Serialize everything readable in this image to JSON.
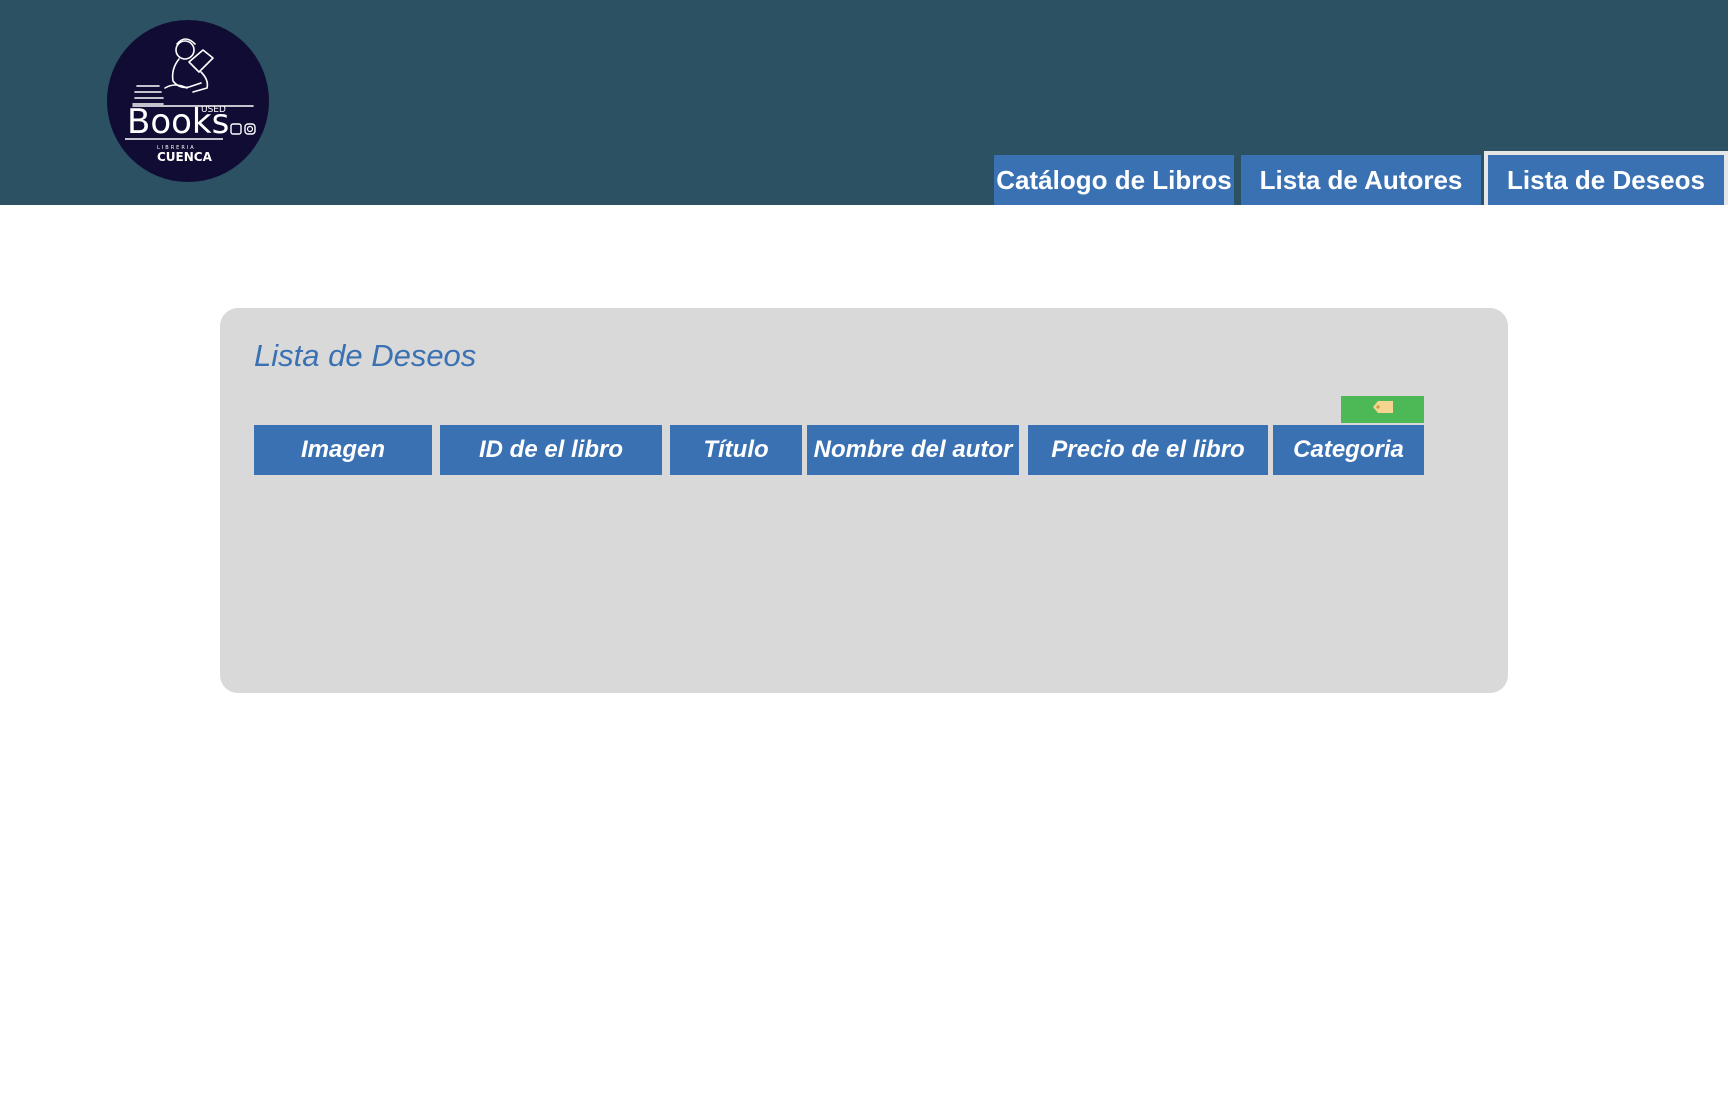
{
  "logo": {
    "main_text": "Books",
    "small_text": "USED",
    "sub_text": "LIBRERIA",
    "city_text": "CUENCA"
  },
  "nav": {
    "tabs": [
      {
        "label": "Catálogo de Libros",
        "active": false
      },
      {
        "label": "Lista de Autores",
        "active": false
      },
      {
        "label": "Lista de Deseos",
        "active": true
      }
    ]
  },
  "wishlist": {
    "title": "Lista de Deseos",
    "tag_button_icon": "tag-icon",
    "columns": [
      "Imagen",
      "ID de el libro",
      "Título",
      "Nombre del autor",
      "Precio de el libro",
      "Categoria"
    ],
    "rows": []
  },
  "colors": {
    "header_bg": "#2b5163",
    "accent_blue": "#3a71b3",
    "panel_bg": "#d9d9d9",
    "tag_green": "#4cb956",
    "logo_bg": "#100c34"
  }
}
